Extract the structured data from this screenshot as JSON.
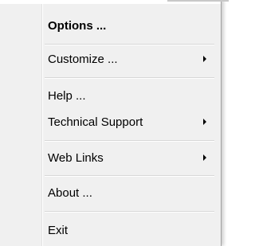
{
  "menu": {
    "items": [
      {
        "label": "Options ...",
        "bold": true,
        "submenu": false
      },
      {
        "label": "Customize ...",
        "bold": false,
        "submenu": true
      },
      {
        "label": "Help ...",
        "bold": false,
        "submenu": false
      },
      {
        "label": "Technical Support",
        "bold": false,
        "submenu": true
      },
      {
        "label": "Web Links",
        "bold": false,
        "submenu": true
      },
      {
        "label": "About ...",
        "bold": false,
        "submenu": false
      },
      {
        "label": "Exit",
        "bold": false,
        "submenu": false
      }
    ],
    "submenu_arrow_icon": "triangle-right-icon",
    "colors": {
      "background": "#f0f0f0",
      "text": "#000000",
      "separator": "#d7d7d7"
    }
  }
}
